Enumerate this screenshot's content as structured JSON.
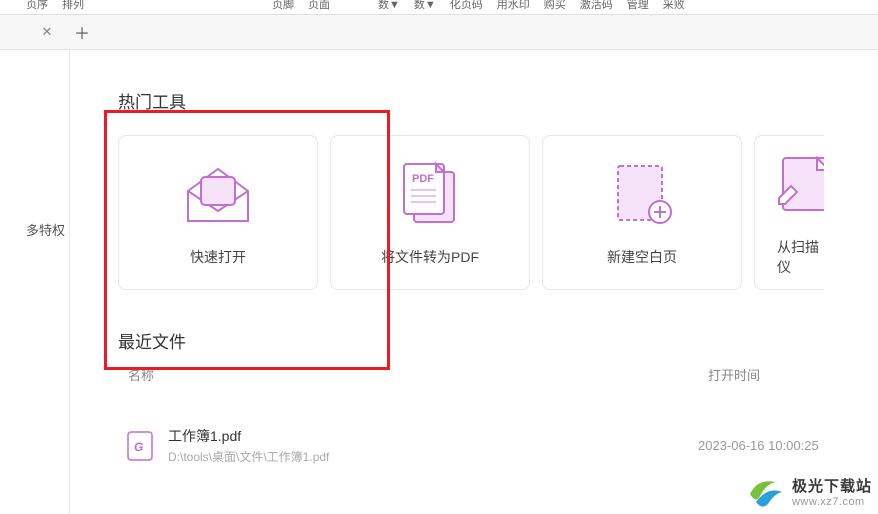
{
  "ribbon": {
    "items": [
      {
        "l1": "",
        "l2": ""
      },
      {
        "l1": "页序",
        "l2": ""
      },
      {
        "l1": "排列",
        "l2": ""
      },
      {
        "l1": "",
        "l2": ""
      },
      {
        "l1": "",
        "l2": ""
      },
      {
        "l1": "",
        "l2": ""
      },
      {
        "l1": "",
        "l2": ""
      },
      {
        "l1": "",
        "l2": ""
      },
      {
        "l1": "",
        "l2": ""
      },
      {
        "l1": "页脚",
        "l2": ""
      },
      {
        "l1": "页面",
        "l2": ""
      },
      {
        "l1": "",
        "l2": ""
      },
      {
        "l1": "数▼",
        "l2": ""
      },
      {
        "l1": "数▼",
        "l2": ""
      },
      {
        "l1": "化页码",
        "l2": ""
      },
      {
        "l1": "用水印",
        "l2": ""
      },
      {
        "l1": "购买",
        "l2": ""
      },
      {
        "l1": "激活码",
        "l2": ""
      },
      {
        "l1": "管理",
        "l2": ""
      },
      {
        "l1": "采败",
        "l2": ""
      }
    ]
  },
  "sidebar": {
    "privilege": "多特权"
  },
  "sections": {
    "hot_tools": "热门工具",
    "recent_files": "最近文件"
  },
  "cards": [
    {
      "label": "快速打开",
      "icon": "envelope"
    },
    {
      "label": "将文件转为PDF",
      "icon": "pdf"
    },
    {
      "label": "新建空白页",
      "icon": "blank-add"
    },
    {
      "label": "从扫描仪",
      "icon": "scan"
    }
  ],
  "list": {
    "col_name": "名称",
    "col_time": "打开时间"
  },
  "files": [
    {
      "name": "工作簿1.pdf",
      "path": "D:\\tools\\桌面\\文件\\工作簿1.pdf",
      "time": "2023-06-16 10:00:25"
    }
  ],
  "watermark": {
    "title": "极光下载站",
    "url": "www.xz7.com"
  },
  "colors": {
    "accent": "#c26fd1",
    "accent_fill": "#f6e3f9",
    "red": "#ec1c24"
  }
}
